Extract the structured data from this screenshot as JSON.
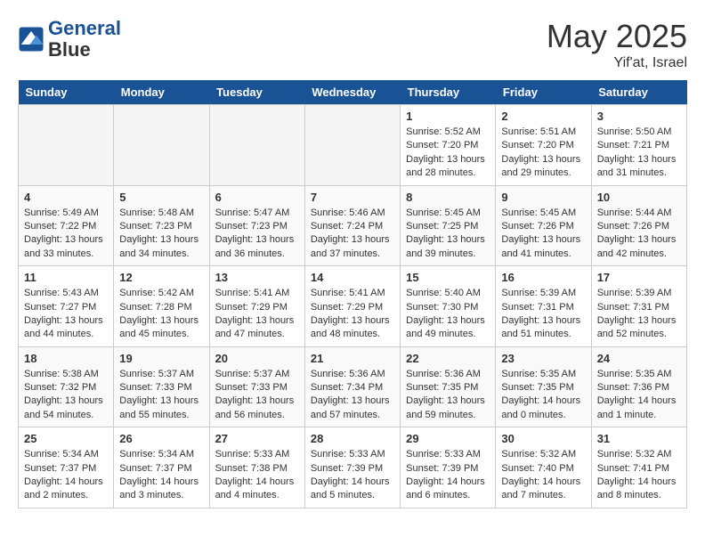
{
  "header": {
    "logo_line1": "General",
    "logo_line2": "Blue",
    "month_title": "May 2025",
    "location": "Yif'at, Israel"
  },
  "days_of_week": [
    "Sunday",
    "Monday",
    "Tuesday",
    "Wednesday",
    "Thursday",
    "Friday",
    "Saturday"
  ],
  "weeks": [
    [
      {
        "day": "",
        "info": ""
      },
      {
        "day": "",
        "info": ""
      },
      {
        "day": "",
        "info": ""
      },
      {
        "day": "",
        "info": ""
      },
      {
        "day": "1",
        "info": "Sunrise: 5:52 AM\nSunset: 7:20 PM\nDaylight: 13 hours\nand 28 minutes."
      },
      {
        "day": "2",
        "info": "Sunrise: 5:51 AM\nSunset: 7:20 PM\nDaylight: 13 hours\nand 29 minutes."
      },
      {
        "day": "3",
        "info": "Sunrise: 5:50 AM\nSunset: 7:21 PM\nDaylight: 13 hours\nand 31 minutes."
      }
    ],
    [
      {
        "day": "4",
        "info": "Sunrise: 5:49 AM\nSunset: 7:22 PM\nDaylight: 13 hours\nand 33 minutes."
      },
      {
        "day": "5",
        "info": "Sunrise: 5:48 AM\nSunset: 7:23 PM\nDaylight: 13 hours\nand 34 minutes."
      },
      {
        "day": "6",
        "info": "Sunrise: 5:47 AM\nSunset: 7:23 PM\nDaylight: 13 hours\nand 36 minutes."
      },
      {
        "day": "7",
        "info": "Sunrise: 5:46 AM\nSunset: 7:24 PM\nDaylight: 13 hours\nand 37 minutes."
      },
      {
        "day": "8",
        "info": "Sunrise: 5:45 AM\nSunset: 7:25 PM\nDaylight: 13 hours\nand 39 minutes."
      },
      {
        "day": "9",
        "info": "Sunrise: 5:45 AM\nSunset: 7:26 PM\nDaylight: 13 hours\nand 41 minutes."
      },
      {
        "day": "10",
        "info": "Sunrise: 5:44 AM\nSunset: 7:26 PM\nDaylight: 13 hours\nand 42 minutes."
      }
    ],
    [
      {
        "day": "11",
        "info": "Sunrise: 5:43 AM\nSunset: 7:27 PM\nDaylight: 13 hours\nand 44 minutes."
      },
      {
        "day": "12",
        "info": "Sunrise: 5:42 AM\nSunset: 7:28 PM\nDaylight: 13 hours\nand 45 minutes."
      },
      {
        "day": "13",
        "info": "Sunrise: 5:41 AM\nSunset: 7:29 PM\nDaylight: 13 hours\nand 47 minutes."
      },
      {
        "day": "14",
        "info": "Sunrise: 5:41 AM\nSunset: 7:29 PM\nDaylight: 13 hours\nand 48 minutes."
      },
      {
        "day": "15",
        "info": "Sunrise: 5:40 AM\nSunset: 7:30 PM\nDaylight: 13 hours\nand 49 minutes."
      },
      {
        "day": "16",
        "info": "Sunrise: 5:39 AM\nSunset: 7:31 PM\nDaylight: 13 hours\nand 51 minutes."
      },
      {
        "day": "17",
        "info": "Sunrise: 5:39 AM\nSunset: 7:31 PM\nDaylight: 13 hours\nand 52 minutes."
      }
    ],
    [
      {
        "day": "18",
        "info": "Sunrise: 5:38 AM\nSunset: 7:32 PM\nDaylight: 13 hours\nand 54 minutes."
      },
      {
        "day": "19",
        "info": "Sunrise: 5:37 AM\nSunset: 7:33 PM\nDaylight: 13 hours\nand 55 minutes."
      },
      {
        "day": "20",
        "info": "Sunrise: 5:37 AM\nSunset: 7:33 PM\nDaylight: 13 hours\nand 56 minutes."
      },
      {
        "day": "21",
        "info": "Sunrise: 5:36 AM\nSunset: 7:34 PM\nDaylight: 13 hours\nand 57 minutes."
      },
      {
        "day": "22",
        "info": "Sunrise: 5:36 AM\nSunset: 7:35 PM\nDaylight: 13 hours\nand 59 minutes."
      },
      {
        "day": "23",
        "info": "Sunrise: 5:35 AM\nSunset: 7:35 PM\nDaylight: 14 hours\nand 0 minutes."
      },
      {
        "day": "24",
        "info": "Sunrise: 5:35 AM\nSunset: 7:36 PM\nDaylight: 14 hours\nand 1 minute."
      }
    ],
    [
      {
        "day": "25",
        "info": "Sunrise: 5:34 AM\nSunset: 7:37 PM\nDaylight: 14 hours\nand 2 minutes."
      },
      {
        "day": "26",
        "info": "Sunrise: 5:34 AM\nSunset: 7:37 PM\nDaylight: 14 hours\nand 3 minutes."
      },
      {
        "day": "27",
        "info": "Sunrise: 5:33 AM\nSunset: 7:38 PM\nDaylight: 14 hours\nand 4 minutes."
      },
      {
        "day": "28",
        "info": "Sunrise: 5:33 AM\nSunset: 7:39 PM\nDaylight: 14 hours\nand 5 minutes."
      },
      {
        "day": "29",
        "info": "Sunrise: 5:33 AM\nSunset: 7:39 PM\nDaylight: 14 hours\nand 6 minutes."
      },
      {
        "day": "30",
        "info": "Sunrise: 5:32 AM\nSunset: 7:40 PM\nDaylight: 14 hours\nand 7 minutes."
      },
      {
        "day": "31",
        "info": "Sunrise: 5:32 AM\nSunset: 7:41 PM\nDaylight: 14 hours\nand 8 minutes."
      }
    ]
  ]
}
